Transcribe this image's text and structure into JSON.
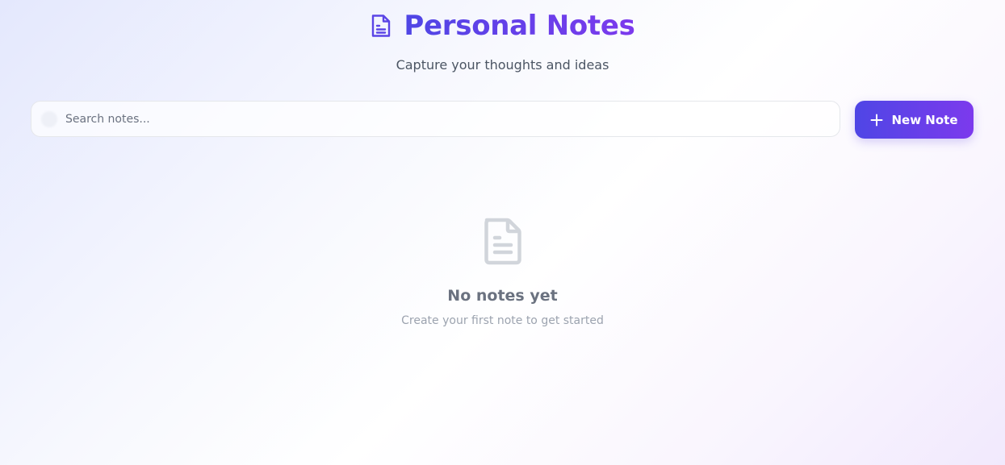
{
  "header": {
    "icon": "document-icon",
    "title": "Personal Notes",
    "subtitle": "Capture your thoughts and ideas"
  },
  "search": {
    "icon": "search-icon",
    "placeholder": "Search notes...",
    "value": ""
  },
  "toolbar": {
    "new_note_icon": "plus-icon",
    "new_note_label": "New Note"
  },
  "empty_state": {
    "icon": "document-icon",
    "title": "No notes yet",
    "subtitle": "Create your first note to get started"
  },
  "colors": {
    "accent_start": "#4f46e5",
    "accent_end": "#7c3aed",
    "muted_icon": "#d1d5db"
  }
}
